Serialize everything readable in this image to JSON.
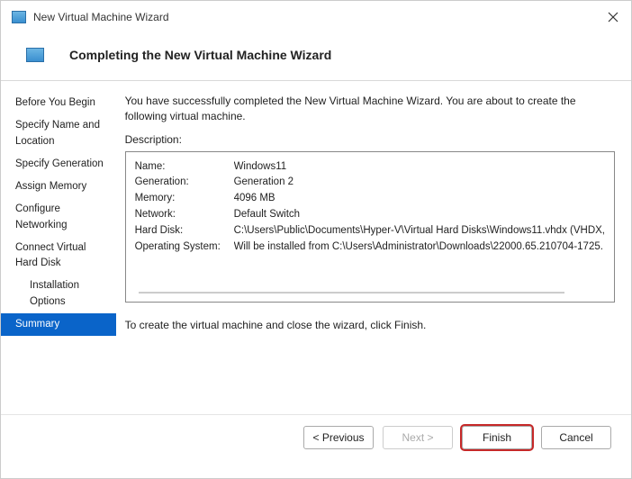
{
  "titlebar": {
    "text": "New Virtual Machine Wizard"
  },
  "header": {
    "title": "Completing the New Virtual Machine Wizard"
  },
  "sidebar": {
    "items": [
      {
        "label": "Before You Begin",
        "indent": false,
        "active": false
      },
      {
        "label": "Specify Name and Location",
        "indent": false,
        "active": false
      },
      {
        "label": "Specify Generation",
        "indent": false,
        "active": false
      },
      {
        "label": "Assign Memory",
        "indent": false,
        "active": false
      },
      {
        "label": "Configure Networking",
        "indent": false,
        "active": false
      },
      {
        "label": "Connect Virtual Hard Disk",
        "indent": false,
        "active": false
      },
      {
        "label": "Installation Options",
        "indent": true,
        "active": false
      },
      {
        "label": "Summary",
        "indent": false,
        "active": true
      }
    ]
  },
  "content": {
    "intro": "You have successfully completed the New Virtual Machine Wizard. You are about to create the following virtual machine.",
    "desc_label": "Description:",
    "details": [
      {
        "key": "Name:",
        "value": "Windows11"
      },
      {
        "key": "Generation:",
        "value": "Generation 2"
      },
      {
        "key": "Memory:",
        "value": "4096 MB"
      },
      {
        "key": "Network:",
        "value": "Default Switch"
      },
      {
        "key": "Hard Disk:",
        "value": "C:\\Users\\Public\\Documents\\Hyper-V\\Virtual Hard Disks\\Windows11.vhdx (VHDX,"
      },
      {
        "key": "Operating System:",
        "value": "Will be installed from C:\\Users\\Administrator\\Downloads\\22000.65.210704-1725."
      }
    ],
    "outro": "To create the virtual machine and close the wizard, click Finish."
  },
  "footer": {
    "previous": "< Previous",
    "next": "Next >",
    "finish": "Finish",
    "cancel": "Cancel"
  }
}
